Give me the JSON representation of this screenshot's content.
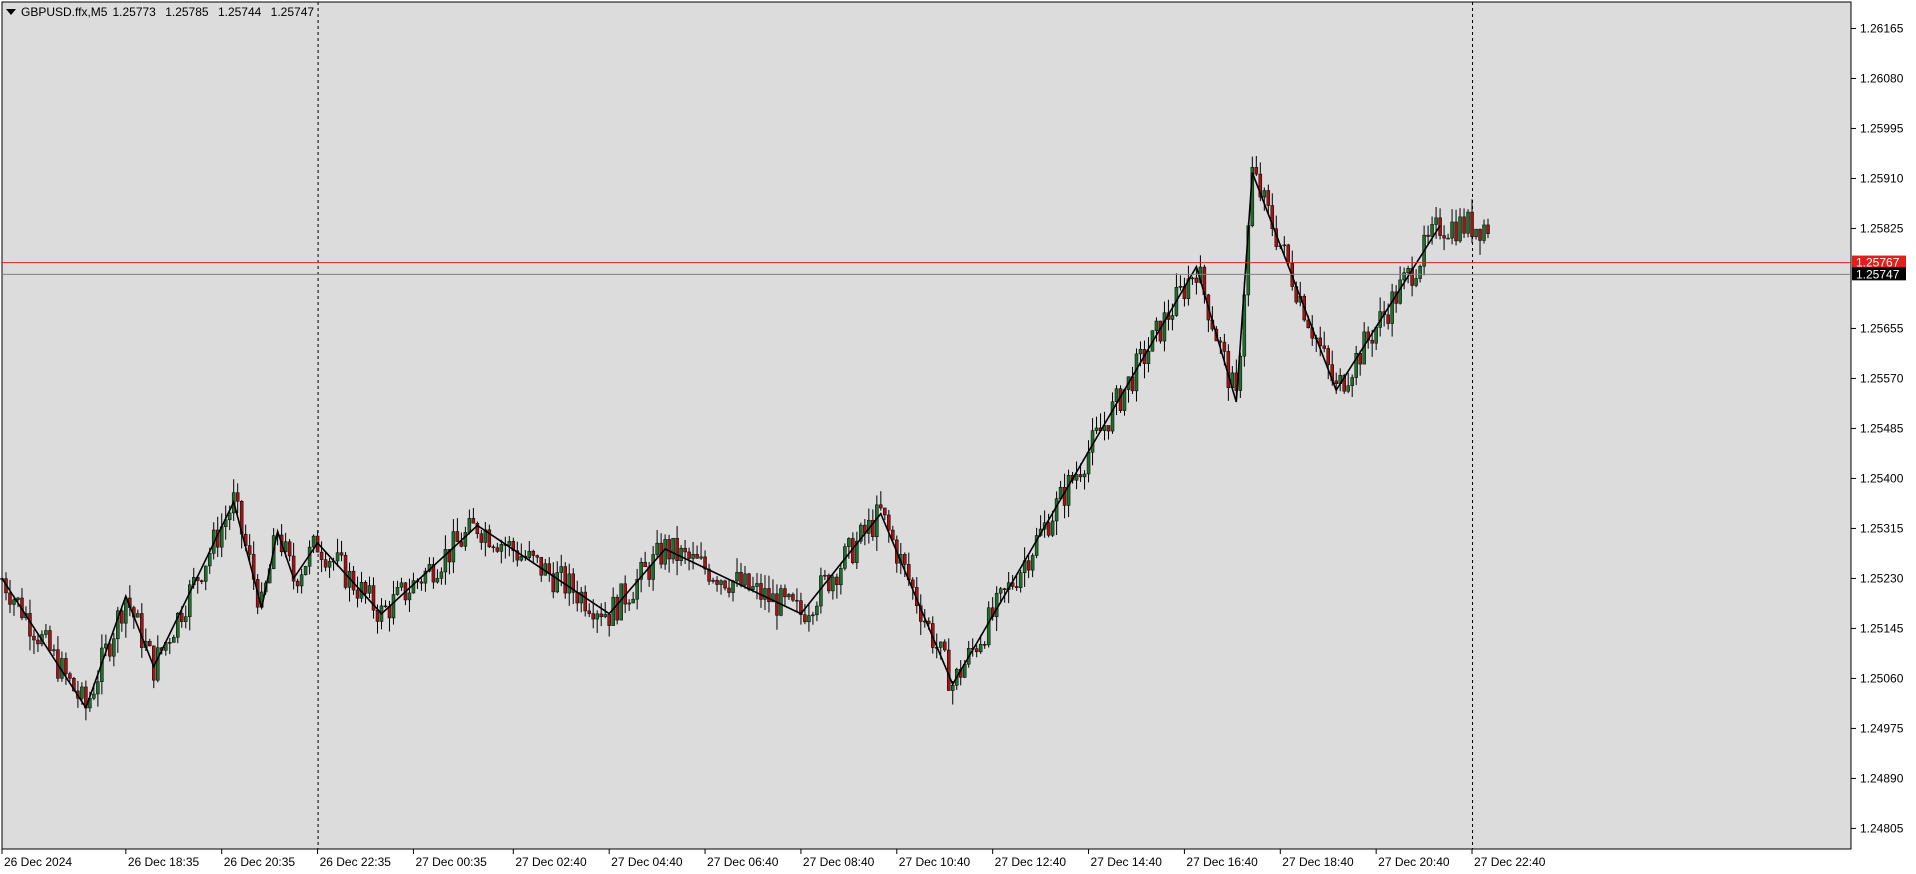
{
  "header": {
    "symbol": "GBPUSD.ffx,M5",
    "open": "1.25773",
    "high": "1.25785",
    "low": "1.25744",
    "close": "1.25747"
  },
  "colors": {
    "background": "#dcdcdc",
    "border": "#000000",
    "bull_candle": "#1f6e2a",
    "bear_candle": "#a01414",
    "zigzag": "#000000",
    "ask_line": "#e02020",
    "bid_line": "#808080",
    "ask_label_bg": "#e02020",
    "bid_label_bg": "#000000"
  },
  "chart_data": {
    "type": "candlestick",
    "symbol": "GBPUSD.ffx",
    "timeframe": "M5",
    "y_axis_ticks": [
      "1.26165",
      "1.26080",
      "1.25995",
      "1.25910",
      "1.25825",
      "1.25655",
      "1.25570",
      "1.25485",
      "1.25400",
      "1.25315",
      "1.25230",
      "1.25145",
      "1.25060",
      "1.24975",
      "1.24890",
      "1.24805"
    ],
    "x_axis_ticks": [
      "26 Dec 2024",
      "26 Dec 18:35",
      "26 Dec 20:35",
      "26 Dec 22:35",
      "27 Dec 00:35",
      "27 Dec 02:40",
      "27 Dec 04:40",
      "27 Dec 06:40",
      "27 Dec 08:40",
      "27 Dec 10:40",
      "27 Dec 12:40",
      "27 Dec 14:40",
      "27 Dec 16:40",
      "27 Dec 18:40",
      "27 Dec 20:40",
      "27 Dec 22:40"
    ],
    "ylim": [
      1.2477,
      1.2621
    ],
    "ask_price": "1.25767",
    "bid_price": "1.25747",
    "period_separators": [
      "26 Dec 22:35",
      "27 Dec 22:40"
    ],
    "zigzag": [
      {
        "t": "26 Dec 2024",
        "price": 1.2523
      },
      {
        "t": "26 Dec 17:45",
        "price": 1.2501
      },
      {
        "t": "26 Dec 18:35",
        "price": 1.252
      },
      {
        "t": "26 Dec 19:10",
        "price": 1.2508
      },
      {
        "t": "26 Dec 20:50",
        "price": 1.2536
      },
      {
        "t": "26 Dec 21:25",
        "price": 1.2518
      },
      {
        "t": "26 Dec 21:45",
        "price": 1.2531
      },
      {
        "t": "26 Dec 22:05",
        "price": 1.2523
      },
      {
        "t": "26 Dec 22:35",
        "price": 1.2529
      },
      {
        "t": "26 Dec 23:55",
        "price": 1.2517
      },
      {
        "t": "27 Dec 01:55",
        "price": 1.2532
      },
      {
        "t": "27 Dec 04:40",
        "price": 1.2517
      },
      {
        "t": "27 Dec 05:50",
        "price": 1.2528
      },
      {
        "t": "27 Dec 08:40",
        "price": 1.2517
      },
      {
        "t": "27 Dec 10:20",
        "price": 1.2534
      },
      {
        "t": "27 Dec 11:50",
        "price": 1.2505
      },
      {
        "t": "27 Dec 16:55",
        "price": 1.2576
      },
      {
        "t": "27 Dec 17:45",
        "price": 1.2553
      },
      {
        "t": "27 Dec 18:05",
        "price": 1.2592
      },
      {
        "t": "27 Dec 19:50",
        "price": 1.2555
      },
      {
        "t": "27 Dec 22:00",
        "price": 1.2583
      }
    ]
  }
}
